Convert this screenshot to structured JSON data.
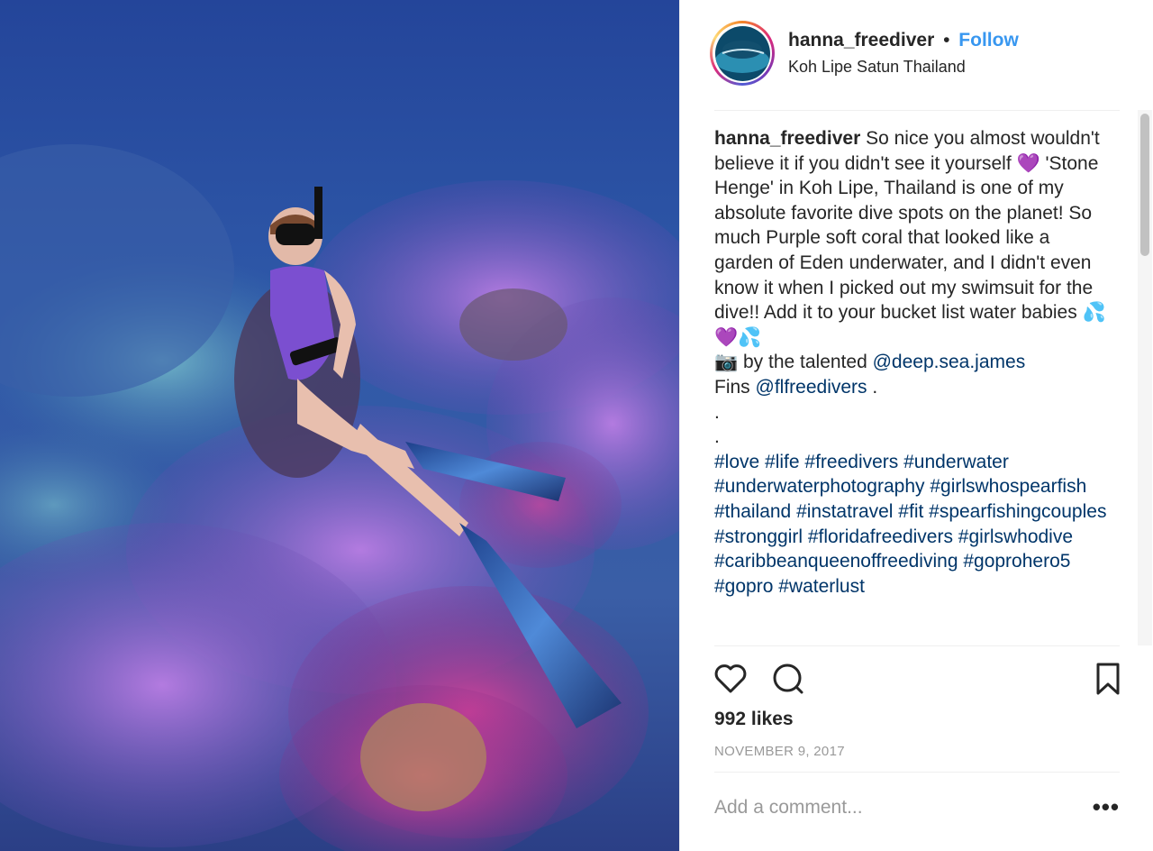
{
  "post": {
    "username": "hanna_freediver",
    "separator": "•",
    "follow_label": "Follow",
    "location": "Koh Lipe Satun Thailand"
  },
  "caption": {
    "author": "hanna_freediver",
    "line1": "So nice you almost wouldn't believe it if you didn't see it yourself 💜 'Stone Henge' in Koh Lipe, Thailand is one of my absolute favorite dive spots on the planet! So much Purple soft coral that looked like a garden of Eden underwater, and I didn't even know it when I picked out my swimsuit for the dive!! Add it to your bucket list water babies 💦💜💦",
    "photo_credit_prefix": "📷 by the talented",
    "photo_credit_mention": "@deep.sea.james",
    "fins_prefix": "Fins",
    "fins_mention": "@flfreedivers",
    "fins_suffix": " .",
    "dot1": ".",
    "dot2": ".",
    "hashtags": "#love #life #freedivers #underwater #underwaterphotography #girlswhospearfish #thailand #instatravel #fit #spearfishingcouples #stronggirl #floridafreedivers #girlswhodive #caribbeanqueenoffreediving #goprohero5 #gopro #waterlust"
  },
  "stats": {
    "likes": "992 likes",
    "date": "NOVEMBER 9, 2017"
  },
  "comment": {
    "placeholder": "Add a comment...",
    "more_label": "•••"
  },
  "icons": {
    "like": "heart-icon",
    "comment": "comment-icon",
    "save": "bookmark-icon",
    "more": "more-options-icon"
  },
  "colors": {
    "follow": "#3897f0",
    "link": "#003569",
    "muted": "#999999"
  }
}
